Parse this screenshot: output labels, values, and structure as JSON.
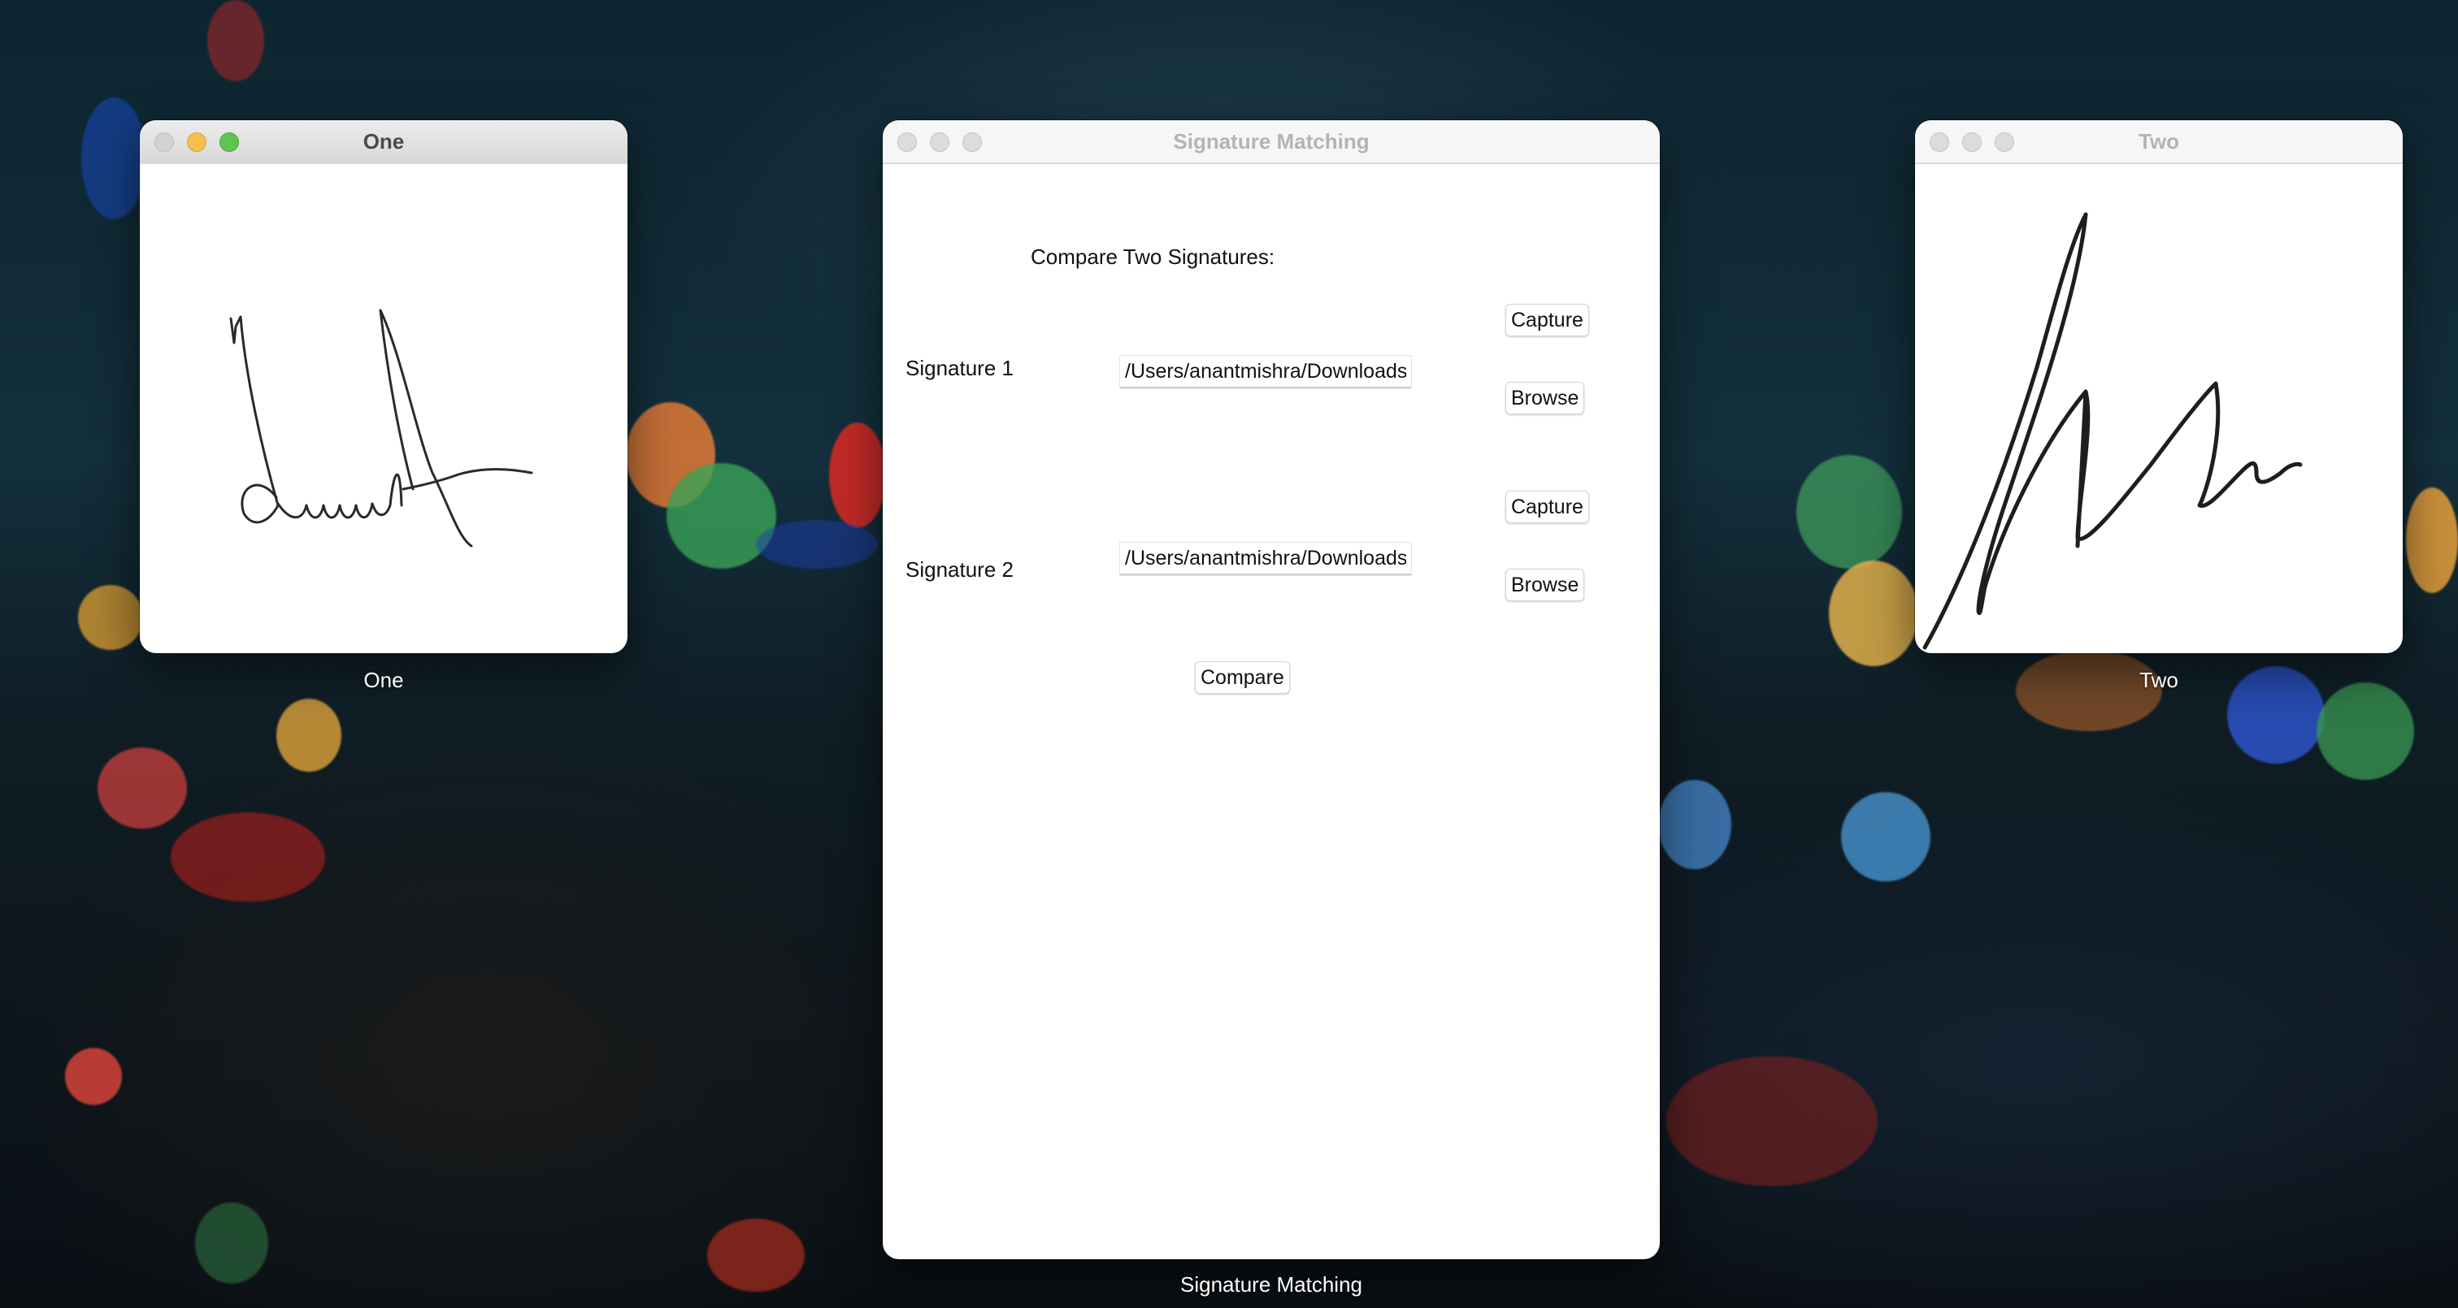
{
  "windows": {
    "one": {
      "title": "One",
      "caption": "One",
      "image_icon": "signature-one-image"
    },
    "main": {
      "title": "Signature Matching",
      "caption": "Signature Matching",
      "heading": "Compare Two Signatures:",
      "signature1": {
        "label": "Signature 1",
        "path_value": "/Users/anantmishra/Downloads",
        "capture_label": "Capture",
        "browse_label": "Browse"
      },
      "signature2": {
        "label": "Signature 2",
        "path_value": "/Users/anantmishra/Downloads",
        "capture_label": "Capture",
        "browse_label": "Browse"
      },
      "compare_label": "Compare"
    },
    "two": {
      "title": "Two",
      "caption": "Two",
      "image_icon": "signature-two-image"
    }
  },
  "colors": {
    "traffic_red": "#d2d2d2",
    "traffic_yellow": "#f5bf4f",
    "traffic_green": "#5fc454"
  }
}
